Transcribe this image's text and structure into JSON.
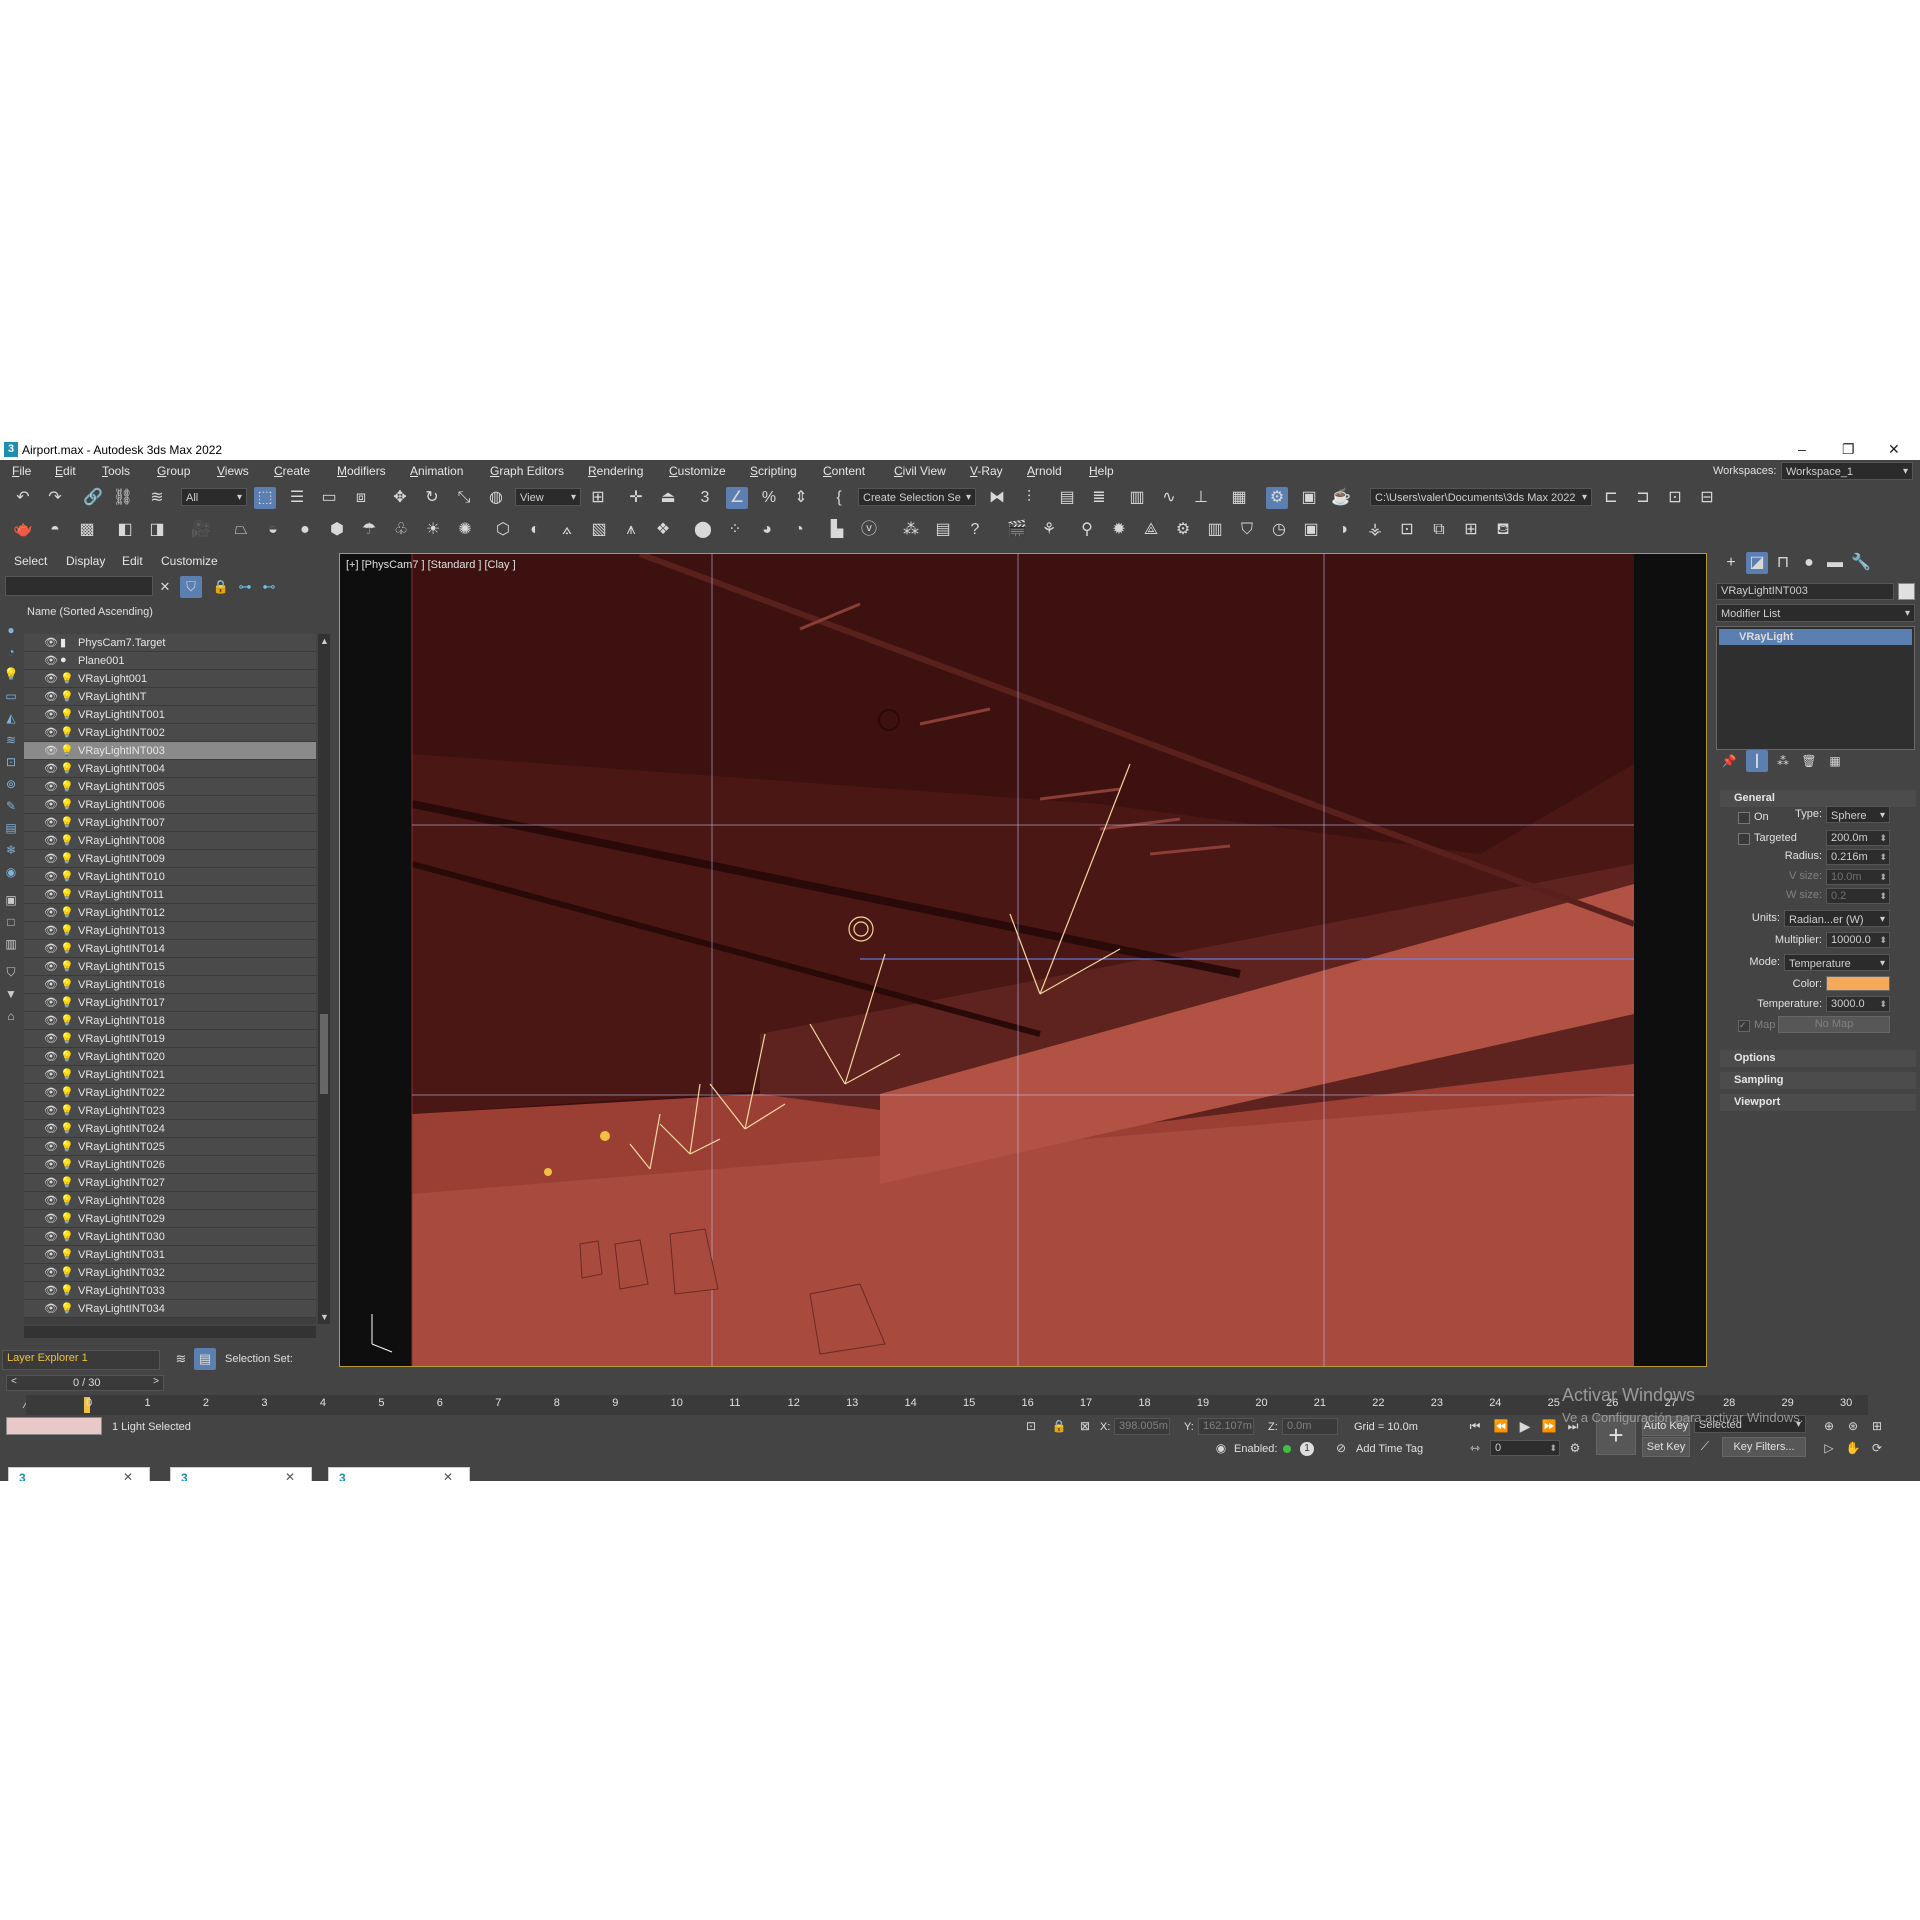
{
  "window": {
    "title": "Airport.max - Autodesk 3ds Max 2022",
    "app_icon": "3"
  },
  "menu": [
    "File",
    "Edit",
    "Tools",
    "Group",
    "Views",
    "Create",
    "Modifiers",
    "Animation",
    "Graph Editors",
    "Rendering",
    "Customize",
    "Scripting",
    "Content",
    "Civil View",
    "V-Ray",
    "Arnold",
    "Help"
  ],
  "workspace": {
    "label": "Workspaces:",
    "value": "Workspace_1"
  },
  "toolbar": {
    "filter": "All",
    "ref_coord": "View",
    "selection_set": "Create Selection Se",
    "project_path": "C:\\Users\\valer\\Documents\\3ds Max 2022"
  },
  "explorer": {
    "tabs": [
      "Select",
      "Display",
      "Edit",
      "Customize"
    ],
    "column_header": "Name (Sorted Ascending)",
    "items": [
      "PhysCam7.Target",
      "Plane001",
      "VRayLight001",
      "VRayLightINT",
      "VRayLightINT001",
      "VRayLightINT002",
      "VRayLightINT003",
      "VRayLightINT004",
      "VRayLightINT005",
      "VRayLightINT006",
      "VRayLightINT007",
      "VRayLightINT008",
      "VRayLightINT009",
      "VRayLightINT010",
      "VRayLightINT011",
      "VRayLightINT012",
      "VRayLightINT013",
      "VRayLightINT014",
      "VRayLightINT015",
      "VRayLightINT016",
      "VRayLightINT017",
      "VRayLightINT018",
      "VRayLightINT019",
      "VRayLightINT020",
      "VRayLightINT021",
      "VRayLightINT022",
      "VRayLightINT023",
      "VRayLightINT024",
      "VRayLightINT025",
      "VRayLightINT026",
      "VRayLightINT027",
      "VRayLightINT028",
      "VRayLightINT029",
      "VRayLightINT030",
      "VRayLightINT031",
      "VRayLightINT032",
      "VRayLightINT033",
      "VRayLightINT034"
    ],
    "selected_item": "VRayLightINT003",
    "layer_explorer": "Layer Explorer 1",
    "selection_set_label": "Selection Set:"
  },
  "viewport": {
    "label": "[+] [PhysCam7 ] [Standard ] [Clay ]"
  },
  "command_panel": {
    "object_name": "VRayLightINT003",
    "modifier_list": "Modifier List",
    "stack_item": "VRayLight",
    "general": {
      "title": "General",
      "on_label": "On",
      "type_label": "Type:",
      "type_value": "Sphere",
      "targeted_label": "Targeted",
      "targeted_value": "200.0m",
      "radius_label": "Radius:",
      "radius_value": "0.216m",
      "vsize_label": "V size:",
      "vsize_value": "10.0m",
      "wsize_label": "W size:",
      "wsize_value": "0.2",
      "units_label": "Units:",
      "units_value": "Radian...er (W)",
      "multiplier_label": "Multiplier:",
      "multiplier_value": "10000.0",
      "mode_label": "Mode:",
      "mode_value": "Temperature",
      "color_label": "Color:",
      "color_hex": "#f5a95a",
      "temperature_label": "Temperature:",
      "temperature_value": "3000.0",
      "map_label": "Map",
      "map_value": "No Map"
    },
    "rollouts": [
      "Options",
      "Sampling",
      "Viewport"
    ]
  },
  "timeline": {
    "frame_counter": "0 / 30",
    "ticks": [
      "0",
      "1",
      "2",
      "3",
      "4",
      "5",
      "6",
      "7",
      "8",
      "9",
      "10",
      "11",
      "12",
      "13",
      "14",
      "15",
      "16",
      "17",
      "18",
      "19",
      "20",
      "21",
      "22",
      "23",
      "24",
      "25",
      "26",
      "27",
      "28",
      "29",
      "30"
    ]
  },
  "status": {
    "selection": "1 Light Selected",
    "x_label": "X:",
    "x_value": "398.005m",
    "y_label": "Y:",
    "y_value": "162.107m",
    "z_label": "Z:",
    "z_value": "0.0m",
    "grid": "Grid = 10.0m",
    "enabled_label": "Enabled:",
    "add_time_tag": "Add Time Tag",
    "auto_key": "Auto Key",
    "set_key": "Set Key",
    "key_mode": "Selected",
    "key_filters": "Key Filters...",
    "frame_value": "0",
    "watermark_title": "Activar Windows",
    "watermark_sub": "Ve a Configuración para activar Windows."
  },
  "colors": {
    "ui_bg": "#444444",
    "accent": "#5a7fb0",
    "scene_red": "#a94a3e"
  }
}
